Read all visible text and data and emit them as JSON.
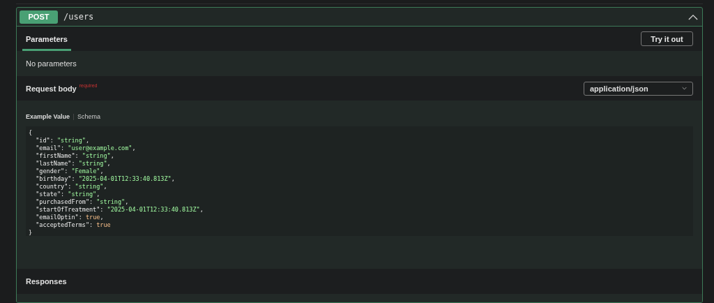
{
  "operation": {
    "method": "POST",
    "path": "/users",
    "expanded": true
  },
  "tabs": [
    {
      "label": "Parameters",
      "selected": true
    }
  ],
  "try_button": "Try it out",
  "parameters_message": "No parameters",
  "request_body": {
    "label": "Request body",
    "required": "required",
    "content_type": "application/json"
  },
  "example_tabs": [
    {
      "label": "Example Value",
      "selected": true
    },
    {
      "label": "Schema",
      "selected": false
    }
  ],
  "example_lines": [
    {
      "kind": "brace",
      "text": "{"
    },
    {
      "kind": "string",
      "key": "  \"id\": ",
      "value": "\"string\"",
      "end": ","
    },
    {
      "kind": "string",
      "key": "  \"email\": ",
      "value": "\"user@example.com\"",
      "end": ","
    },
    {
      "kind": "string",
      "key": "  \"firstName\": ",
      "value": "\"string\"",
      "end": ","
    },
    {
      "kind": "string",
      "key": "  \"lastName\": ",
      "value": "\"string\"",
      "end": ","
    },
    {
      "kind": "string",
      "key": "  \"gender\": ",
      "value": "\"Female\"",
      "end": ","
    },
    {
      "kind": "string",
      "key": "  \"birthday\": ",
      "value": "\"2025-04-01T12:33:40.813Z\"",
      "end": ","
    },
    {
      "kind": "string",
      "key": "  \"country\": ",
      "value": "\"string\"",
      "end": ","
    },
    {
      "kind": "string",
      "key": "  \"state\": ",
      "value": "\"string\"",
      "end": ","
    },
    {
      "kind": "string",
      "key": "  \"purchasedFrom\": ",
      "value": "\"string\"",
      "end": ","
    },
    {
      "kind": "string",
      "key": "  \"startOfTreatment\": ",
      "value": "\"2025-04-01T12:33:40.813Z\"",
      "end": ","
    },
    {
      "kind": "boolean",
      "key": "  \"emailOptin\": ",
      "value": "true",
      "end": ","
    },
    {
      "kind": "boolean",
      "key": "  \"acceptedTerms\": ",
      "value": "true"
    },
    {
      "kind": "brace",
      "text": "}"
    }
  ],
  "responses_label": "Responses"
}
